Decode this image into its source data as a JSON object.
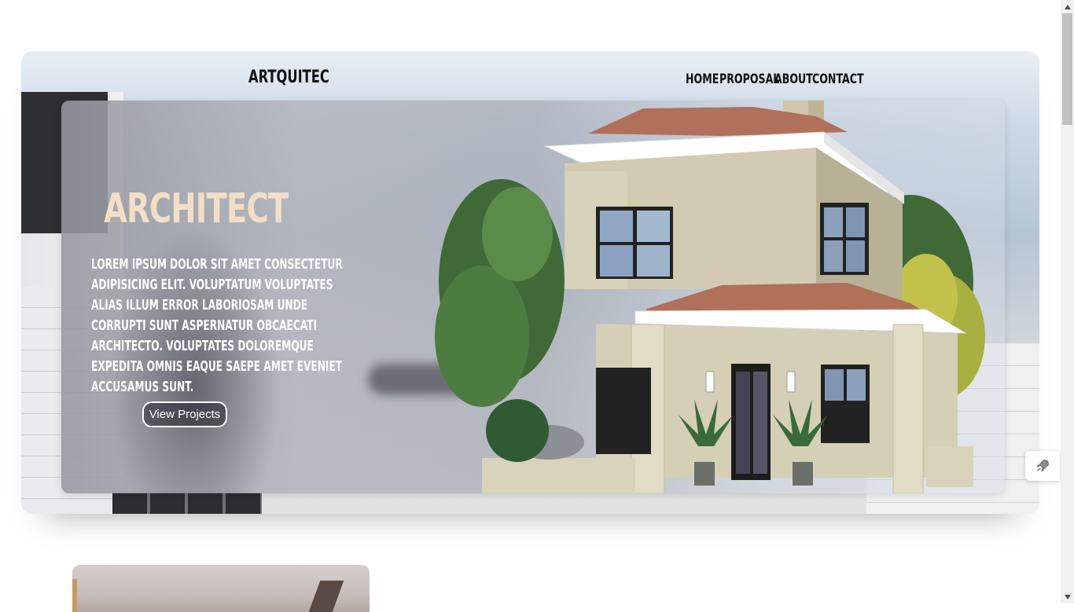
{
  "header": {
    "logo": "ARTQUITEC",
    "nav": [
      {
        "label": "HOME"
      },
      {
        "label": "PROPOSAL"
      },
      {
        "label": "ABOUT"
      },
      {
        "label": "CONTACT"
      }
    ]
  },
  "hero": {
    "headline": "ARCHITECT",
    "paragraph": "LOREM IPSUM DOLOR SIT AMET CONSECTETUR ADIPISICING ELIT. VOLUPTATUM VOLUPTATES ALIAS ILLUM ERROR LABORIOSAM UNDE CORRUPTI SUNT ASPERNATUR OBCAECATI ARCHITECTO. VOLUPTATES DOLOREMQUE EXPEDITA OMNIS EAQUE SAEPE AMET EVENIET ACCUSAMUS SUNT.",
    "cta_label": "View Projects",
    "image": "two-story-house"
  },
  "widget": {
    "icon": "rocket-icon"
  },
  "colors": {
    "headline": "#f4dfc6",
    "text": "#111111",
    "hero_text": "#ffffff"
  }
}
